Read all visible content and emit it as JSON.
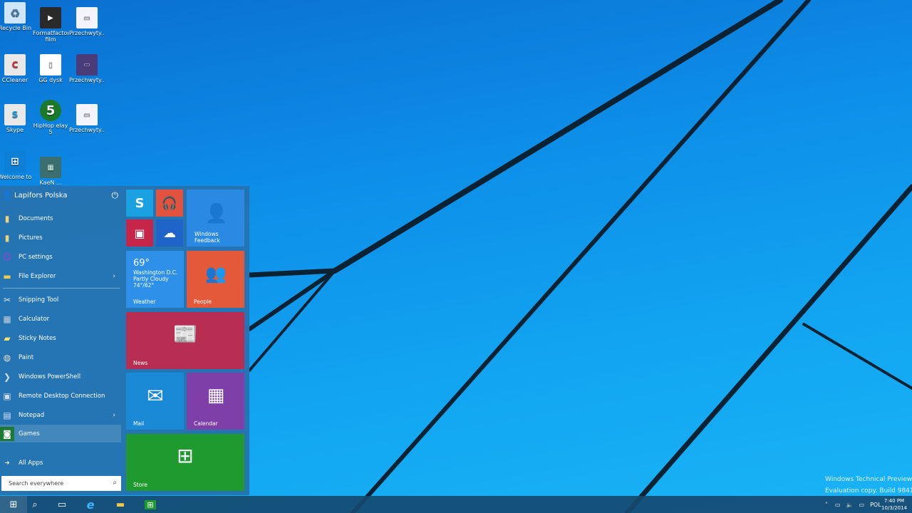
{
  "desktop": {
    "icons": [
      {
        "label": "Recycle Bin",
        "icon": "recycle-bin-icon",
        "color": "#cfe6f8"
      },
      {
        "label": "Formatfactory film",
        "icon": "video-file-icon",
        "color": "#2a2a2a"
      },
      {
        "label": "Przechwyty...",
        "icon": "image-file-icon",
        "color": "#f4f4ff"
      },
      {
        "label": "CCleaner",
        "icon": "ccleaner-icon",
        "color": "#e8e8e8"
      },
      {
        "label": "GG dysk",
        "icon": "document-icon",
        "color": "#ffffff"
      },
      {
        "label": "Przechwyty...",
        "icon": "image-file-icon",
        "color": "#4a3c78"
      },
      {
        "label": "Skype",
        "icon": "skype-shortcut-icon",
        "color": "#e8e8e8"
      },
      {
        "label": "HipHop elay 5",
        "icon": "hiphop-icon",
        "color": "#1b7a2a"
      },
      {
        "label": "Przechwyty...",
        "icon": "image-file-icon",
        "color": "#f4f4ff"
      },
      {
        "label": "Welcome to",
        "icon": "windows-icon",
        "color": "#0c7fd6"
      },
      {
        "label": "KaeN ...",
        "icon": "photo-icon",
        "color": "#3b6e6e"
      }
    ]
  },
  "start_menu": {
    "user_name": "Lapifors Polska",
    "items": [
      {
        "label": "Documents",
        "icon": "documents-icon",
        "glyph": "▮",
        "arrow": ""
      },
      {
        "label": "Pictures",
        "icon": "pictures-icon",
        "glyph": "▮",
        "arrow": ""
      },
      {
        "label": "PC settings",
        "icon": "gear-icon",
        "glyph": "⚙",
        "arrow": ""
      },
      {
        "label": "File Explorer",
        "icon": "folder-icon",
        "glyph": "▬",
        "arrow": "›"
      },
      {
        "label": "Snipping Tool",
        "icon": "scissors-icon",
        "glyph": "✂",
        "arrow": ""
      },
      {
        "label": "Calculator",
        "icon": "calculator-icon",
        "glyph": "▦",
        "arrow": ""
      },
      {
        "label": "Sticky Notes",
        "icon": "sticky-note-icon",
        "glyph": "▰",
        "arrow": ""
      },
      {
        "label": "Paint",
        "icon": "paint-palette-icon",
        "glyph": "◍",
        "arrow": ""
      },
      {
        "label": "Windows PowerShell",
        "icon": "powershell-icon",
        "glyph": "❯",
        "arrow": ""
      },
      {
        "label": "Remote Desktop Connection",
        "icon": "remote-desktop-icon",
        "glyph": "▣",
        "arrow": ""
      },
      {
        "label": "Notepad",
        "icon": "notepad-icon",
        "glyph": "▤",
        "arrow": "›"
      },
      {
        "label": "Games",
        "icon": "gamepad-icon",
        "glyph": "◙",
        "arrow": ""
      }
    ],
    "all_apps_label": "All Apps",
    "search_placeholder": "Search everywhere",
    "tiles": {
      "windows_feedback_label": "Windows Feedback",
      "weather": {
        "temp": "69°",
        "city": "Washington D.C.",
        "condition": "Partly Cloudy",
        "range": "74°/62°",
        "label": "Weather"
      },
      "people_label": "People",
      "news_label": "News",
      "mail_label": "Mail",
      "calendar_label": "Calendar",
      "store_label": "Store"
    },
    "tile_colors": {
      "skype": "#1aa1e1",
      "music": "#e2523e",
      "video": "#c5264a",
      "onedrive": "#1f64c8",
      "feedback": "#2a8ae3",
      "weather": "#2e90e8",
      "people": "#e4593a",
      "news": "#b82d52",
      "mail": "#1a8ad7",
      "calendar": "#7e3fa8",
      "store": "#1f9a2f"
    }
  },
  "taskbar": {
    "lang": "POL",
    "time": "7:40 PM",
    "date": "10/3/2014"
  },
  "watermark": {
    "line1": "Windows Technical Preview",
    "line2": "Evaluation copy. Build 9841"
  }
}
